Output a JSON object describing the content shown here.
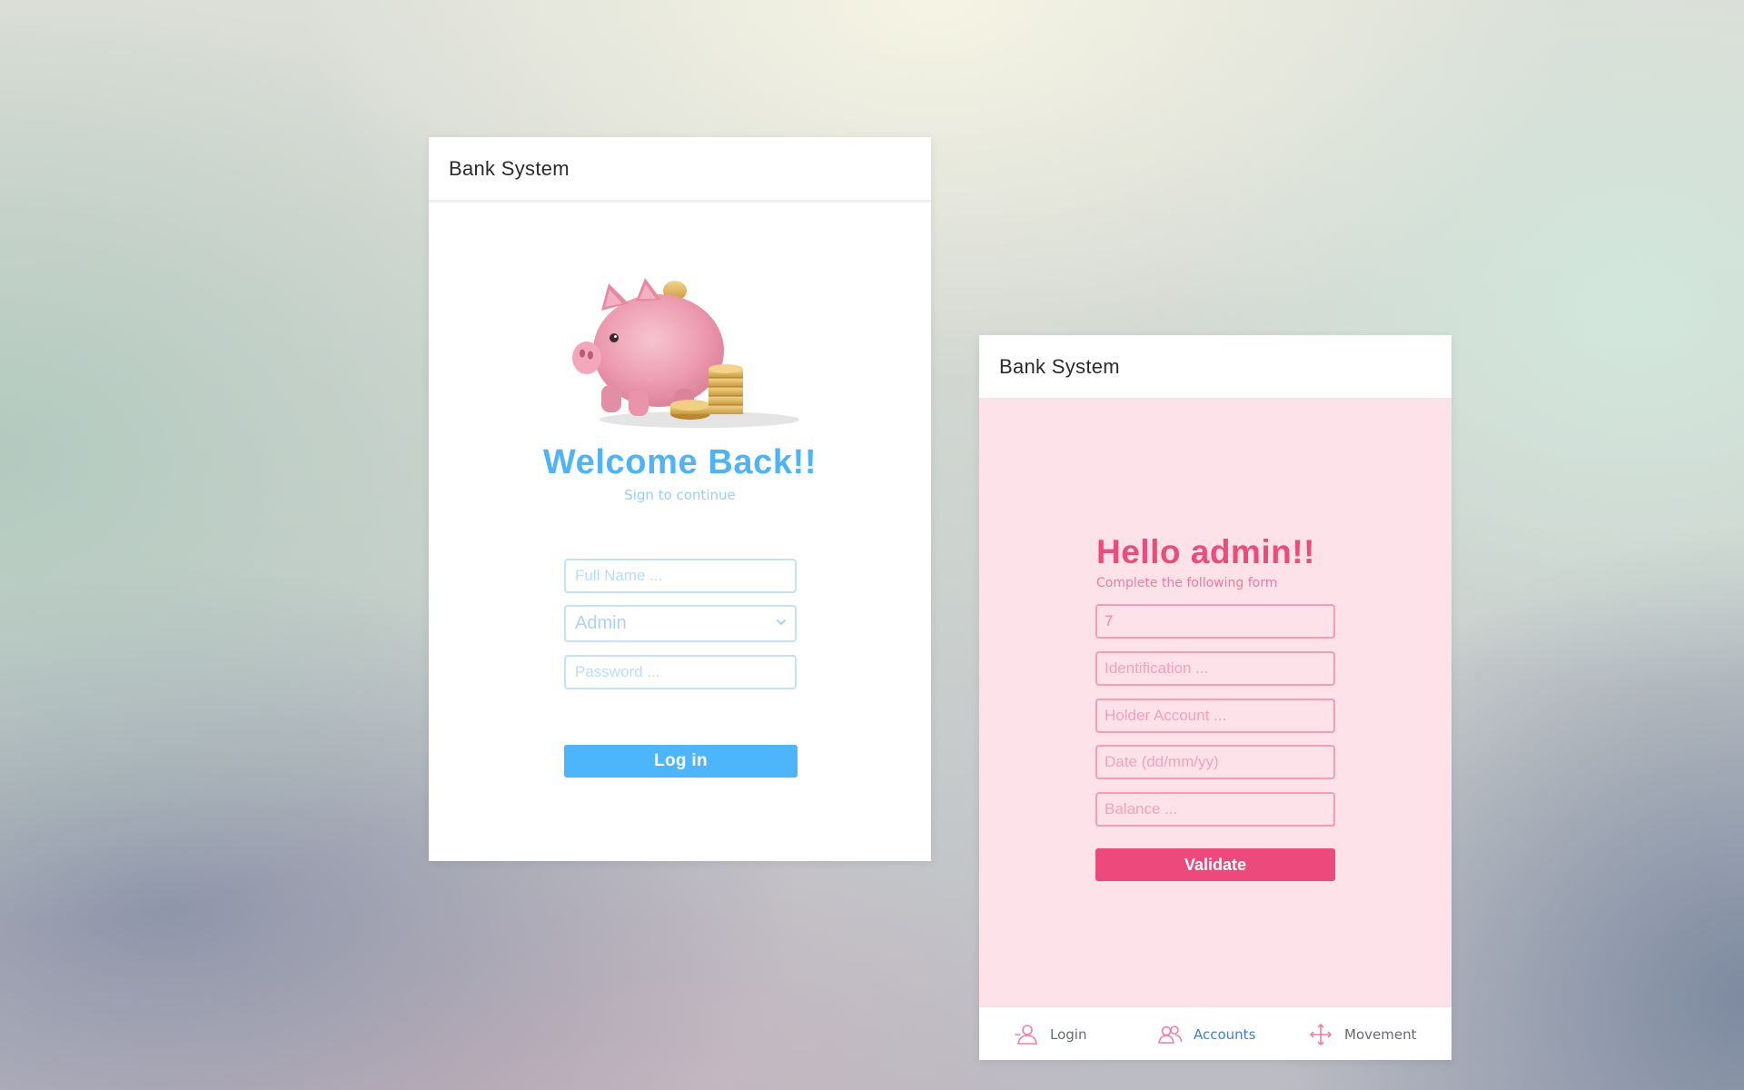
{
  "login_card": {
    "header_title": "Bank System",
    "welcome_title": "Welcome Back!!",
    "welcome_subtitle": "Sign to continue",
    "full_name_placeholder": "Full Name ...",
    "role_select_value": "Admin",
    "password_placeholder": "Password ...",
    "login_button_label": "Log in",
    "accent_color": "#4db5fa",
    "illustration": "piggy-bank-with-coins"
  },
  "accounts_card": {
    "header_title": "Bank System",
    "hello_title": "Hello admin!!",
    "hello_subtitle": "Complete the following form",
    "account_number_value": "7",
    "identification_placeholder": "Identification ...",
    "holder_account_placeholder": "Holder Account ...",
    "date_placeholder": "Date (dd/mm/yy)",
    "balance_placeholder": "Balance ...",
    "validate_button_label": "Validate",
    "accent_color": "#ec4a7c",
    "background_color": "#fde2ea",
    "bottom_nav": {
      "items": [
        {
          "label": "Login",
          "icon": "user-icon",
          "active": false
        },
        {
          "label": "Accounts",
          "icon": "users-icon",
          "active": true
        },
        {
          "label": "Movement",
          "icon": "move-arrows-icon",
          "active": false
        }
      ],
      "active_color": "#3f7fd4",
      "icon_color": "#f27ea5"
    }
  }
}
